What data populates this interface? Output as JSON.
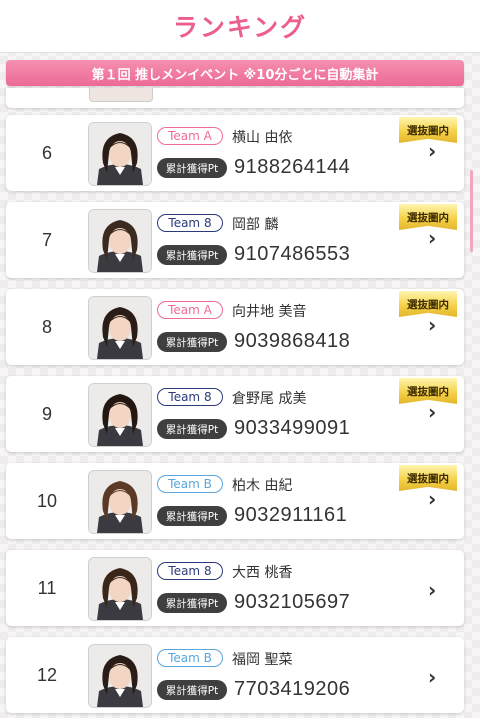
{
  "header": {
    "title": "ランキング"
  },
  "banner": {
    "text": "第１回 推しメンイベント ※10分ごとに自動集計"
  },
  "colors": {
    "accent": "#ec5e8b",
    "teamA": "#ee6b9a",
    "team8": "#2b3a7a",
    "teamB": "#5aa6dc",
    "badge_gold": "#f4d24a"
  },
  "icons": {
    "chevron": "›",
    "chevron_name": "chevron-right-icon"
  },
  "rows": [
    {
      "rank": "6",
      "team": "Team A",
      "team_class": "a",
      "name": "横山 由依",
      "pt_label": "累計獲得Pt",
      "points": "9188264144",
      "badge": "選抜圏内"
    },
    {
      "rank": "7",
      "team": "Team 8",
      "team_class": "eight",
      "name": "岡部 麟",
      "pt_label": "累計獲得Pt",
      "points": "9107486553",
      "badge": "選抜圏内"
    },
    {
      "rank": "8",
      "team": "Team A",
      "team_class": "a",
      "name": "向井地 美音",
      "pt_label": "累計獲得Pt",
      "points": "9039868418",
      "badge": "選抜圏内"
    },
    {
      "rank": "9",
      "team": "Team 8",
      "team_class": "eight",
      "name": "倉野尾 成美",
      "pt_label": "累計獲得Pt",
      "points": "9033499091",
      "badge": "選抜圏内"
    },
    {
      "rank": "10",
      "team": "Team B",
      "team_class": "b",
      "name": "柏木 由紀",
      "pt_label": "累計獲得Pt",
      "points": "9032911161",
      "badge": "選抜圏内"
    },
    {
      "rank": "11",
      "team": "Team 8",
      "team_class": "eight",
      "name": "大西 桃香",
      "pt_label": "累計獲得Pt",
      "points": "9032105697",
      "badge": ""
    },
    {
      "rank": "12",
      "team": "Team B",
      "team_class": "b",
      "name": "福岡 聖菜",
      "pt_label": "累計獲得Pt",
      "points": "7703419206",
      "badge": ""
    }
  ]
}
